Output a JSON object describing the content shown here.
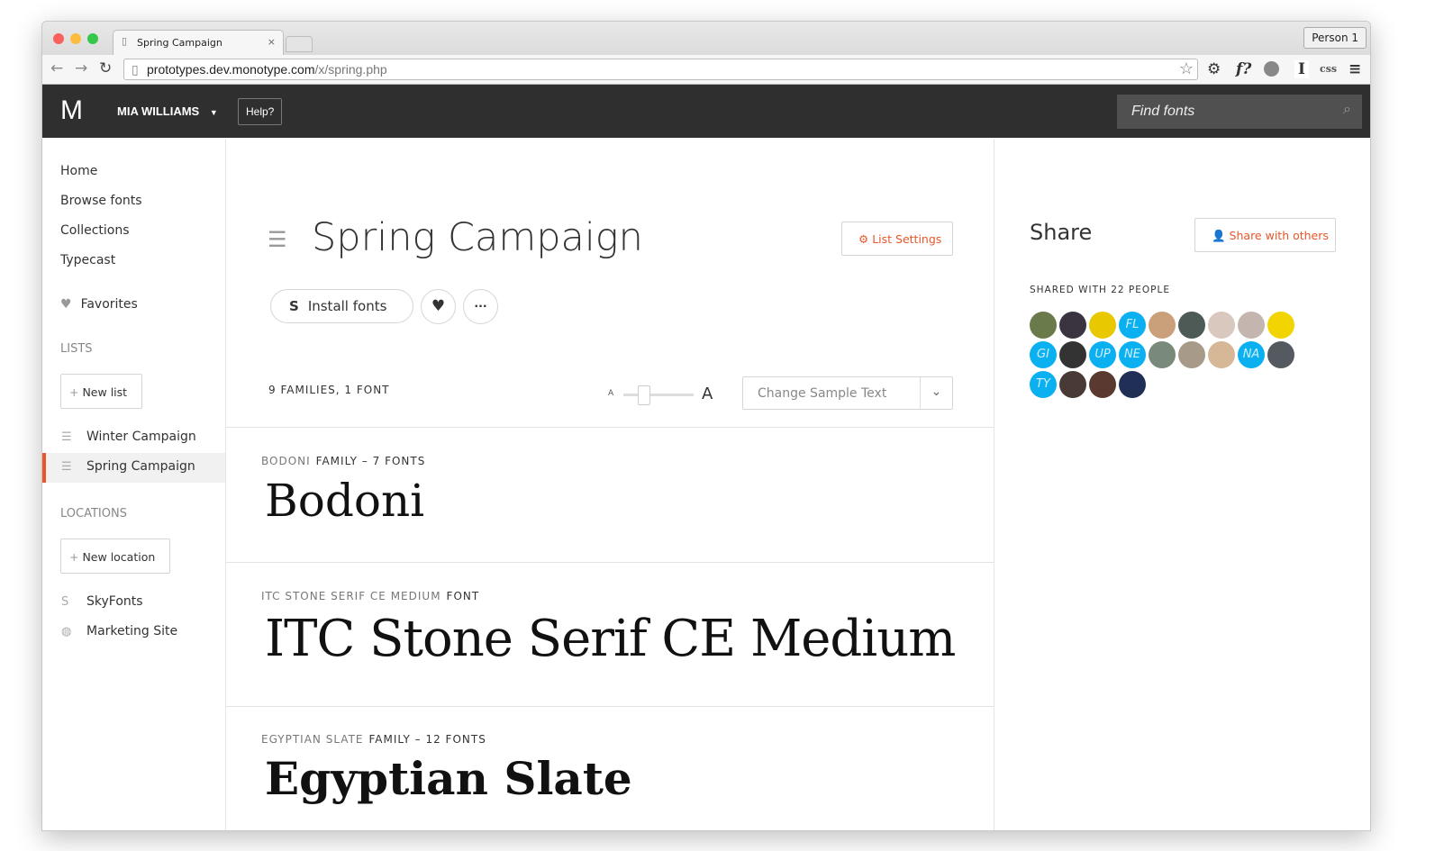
{
  "browser": {
    "tab_title": "Spring Campaign",
    "person": "Person 1",
    "url_host": "prototypes.dev.monotype.com",
    "url_path": "/x/spring.php",
    "extensions": [
      "gear-icon",
      "fontface-ninja-icon",
      "avatar-icon",
      "type-icon",
      "css-icon",
      "menu-icon"
    ],
    "ext_labels": {
      "f": "f?",
      "i": "I",
      "css": "css"
    }
  },
  "header": {
    "logo": "M",
    "user": "MIA WILLIAMS",
    "help": "Help?",
    "search_placeholder": "Find fonts"
  },
  "sidebar": {
    "nav": [
      "Home",
      "Browse fonts",
      "Collections",
      "Typecast"
    ],
    "favorites": "Favorites",
    "lists_heading": "LISTS",
    "new_list": "New list",
    "lists": [
      {
        "label": "Winter Campaign",
        "active": false
      },
      {
        "label": "Spring Campaign",
        "active": true
      }
    ],
    "locations_heading": "LOCATIONS",
    "new_location": "New location",
    "locations": [
      "SkyFonts",
      "Marketing Site"
    ]
  },
  "main": {
    "title": "Spring Campaign",
    "list_settings": "List Settings",
    "install_fonts": "Install fonts",
    "count": "9 FAMILIES, 1 FONT",
    "size_small": "A",
    "size_large": "A",
    "size_slider_value": 0.2,
    "sample_placeholder": "Change Sample Text",
    "fonts": [
      {
        "name": "BODONI",
        "kind": "FAMILY – 7 FONTS",
        "sample": "Bodoni"
      },
      {
        "name": "ITC STONE SERIF CE MEDIUM",
        "kind": "FONT",
        "sample": "ITC Stone Serif CE Medium"
      },
      {
        "name": "EGYPTIAN SLATE",
        "kind": "FAMILY – 12 FONTS",
        "sample": "Egyptian Slate"
      }
    ]
  },
  "share": {
    "title": "Share",
    "button": "Share with others",
    "shared_count": "SHARED WITH 22 PEOPLE",
    "people": [
      {
        "i": "",
        "c": "#6b7a4a"
      },
      {
        "i": "",
        "c": "#3a3340"
      },
      {
        "i": "",
        "c": "#e8c800"
      },
      {
        "i": "FL",
        "c": "#0bb0f0"
      },
      {
        "i": "",
        "c": "#c9a07a"
      },
      {
        "i": "",
        "c": "#4d5a55"
      },
      {
        "i": "",
        "c": "#d8c8bd"
      },
      {
        "i": "",
        "c": "#c4b6ae"
      },
      {
        "i": "",
        "c": "#f2d400"
      },
      {
        "i": "GI",
        "c": "#0bb0f0"
      },
      {
        "i": "",
        "c": "#333333"
      },
      {
        "i": "UP",
        "c": "#0bb0f0"
      },
      {
        "i": "NE",
        "c": "#0bb0f0"
      },
      {
        "i": "",
        "c": "#7a8a7a"
      },
      {
        "i": "",
        "c": "#a89a88"
      },
      {
        "i": "",
        "c": "#d6b896"
      },
      {
        "i": "NA",
        "c": "#0bb0f0"
      },
      {
        "i": "",
        "c": "#555a60"
      },
      {
        "i": "TY",
        "c": "#0bb0f0"
      },
      {
        "i": "",
        "c": "#4a3a36"
      },
      {
        "i": "",
        "c": "#5a3a30"
      },
      {
        "i": "",
        "c": "#1f2f55"
      }
    ]
  },
  "colors": {
    "accent": "#e8562a",
    "header_bg": "#2f2f2f",
    "initials_avatar": "#0bb0f0"
  }
}
